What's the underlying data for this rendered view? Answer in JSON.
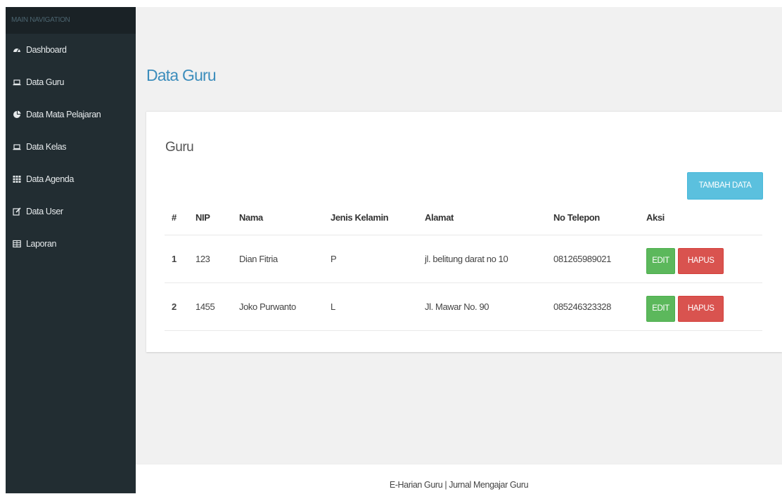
{
  "sidebar": {
    "header": "MAIN NAVIGATION",
    "items": [
      {
        "label": "Dashboard",
        "icon": "dashboard-icon"
      },
      {
        "label": "Data Guru",
        "icon": "laptop-icon"
      },
      {
        "label": "Data Mata Pelajaran",
        "icon": "pie-chart-icon"
      },
      {
        "label": "Data Kelas",
        "icon": "laptop-icon"
      },
      {
        "label": "Data Agenda",
        "icon": "th-icon"
      },
      {
        "label": "Data User",
        "icon": "edit-icon"
      },
      {
        "label": "Laporan",
        "icon": "table-icon"
      }
    ]
  },
  "page": {
    "title": "Data Guru",
    "box_title": "Guru",
    "add_button": "TAMBAH DATA"
  },
  "table": {
    "headers": [
      "#",
      "NIP",
      "Nama",
      "Jenis Kelamin",
      "Alamat",
      "No Telepon",
      "Aksi"
    ],
    "rows": [
      {
        "no": "1",
        "nip": "123",
        "nama": "Dian Fitria",
        "jk": "P",
        "alamat": "jl. belitung darat no 10",
        "telp": "081265989021",
        "edit": "EDIT",
        "hapus": "HAPUS"
      },
      {
        "no": "2",
        "nip": "1455",
        "nama": "Joko Purwanto",
        "jk": "L",
        "alamat": "Jl. Mawar No. 90",
        "telp": "085246323328",
        "edit": "EDIT",
        "hapus": "HAPUS"
      }
    ]
  },
  "footer": {
    "text": "E-Harian Guru | Jurnal Mengajar Guru"
  },
  "colors": {
    "sidebar_bg": "#222d32",
    "title": "#3c8dbc",
    "info": "#5bc0de",
    "success": "#5cb85c",
    "danger": "#d9534f"
  }
}
